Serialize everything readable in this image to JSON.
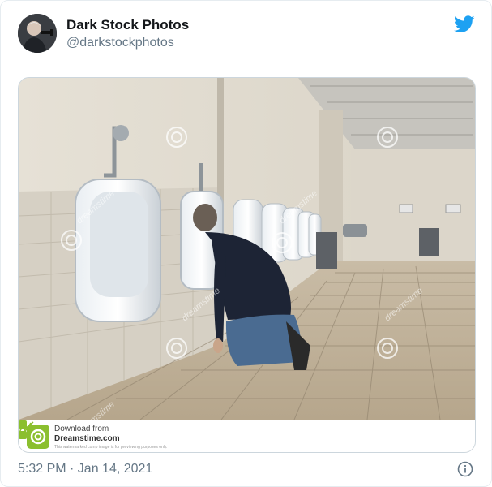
{
  "tweet": {
    "display_name": "Dark Stock Photos",
    "handle": "@darkstockphotos",
    "timestamp": "5:32 PM · Jan 14, 2021"
  },
  "image_overlay": {
    "download_from": "Download from",
    "site": "Dreamstime.com",
    "fine_print": "This watermarked comp image is for previewing purposes only.",
    "watermark_word": "dreamstime"
  },
  "colors": {
    "twitter_blue": "#1da1f2",
    "dreamstime_green": "#8bbf2f",
    "secondary_text": "#657786"
  },
  "icons": {
    "brand": "twitter-bird-icon",
    "info": "info-icon",
    "avatar": "avatar"
  }
}
